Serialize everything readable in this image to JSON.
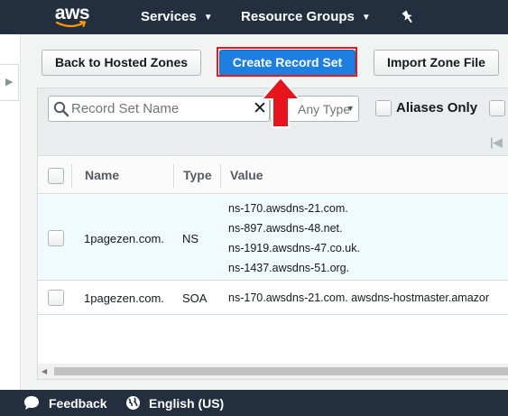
{
  "topnav": {
    "logo": "aws",
    "services_label": "Services",
    "resource_groups_label": "Resource Groups",
    "pin_icon": "pin-icon"
  },
  "toolbar": {
    "back_label": "Back to Hosted Zones",
    "create_label": "Create Record Set",
    "import_label": "Import Zone File"
  },
  "filter": {
    "search_placeholder": "Record Set Name",
    "type_placeholder": "Any Type",
    "aliases_label": "Aliases Only"
  },
  "table": {
    "columns": [
      "Name",
      "Type",
      "Value"
    ],
    "rows": [
      {
        "name": "1pagezen.com.",
        "type": "NS",
        "values": [
          "ns-170.awsdns-21.com.",
          "ns-897.awsdns-48.net.",
          "ns-1919.awsdns-47.co.uk.",
          "ns-1437.awsdns-51.org."
        ],
        "selected": true
      },
      {
        "name": "1pagezen.com.",
        "type": "SOA",
        "values": [
          "ns-170.awsdns-21.com. awsdns-hostmaster.amazor"
        ],
        "selected": false
      }
    ]
  },
  "footer": {
    "feedback_label": "Feedback",
    "language_label": "English (US)"
  },
  "colors": {
    "nav_bg": "#232f3e",
    "primary": "#1d7fe1",
    "highlight": "#e01b1b",
    "selected_row": "#f1faff"
  }
}
